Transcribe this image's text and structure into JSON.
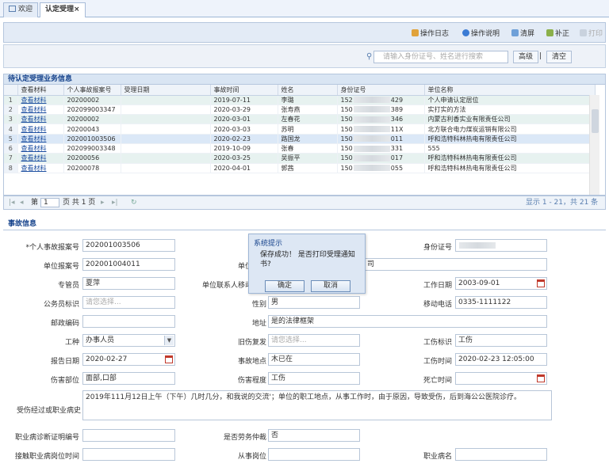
{
  "tabs": [
    {
      "label": "欢迎"
    },
    {
      "label": "认定受理",
      "close": "×"
    }
  ],
  "toolbar": {
    "items": [
      "操作日志",
      "操作说明",
      "清屏",
      "补正",
      "打印"
    ]
  },
  "search": {
    "placeholder": "请输入身份证号、姓名进行搜索",
    "advanced": "高级",
    "separator": "|",
    "clear": "清空"
  },
  "grid": {
    "title": "待认定受理业务信息",
    "columns": [
      "查看材料",
      "个人事故报案号",
      "受理日期",
      "事故时间",
      "姓名",
      "身份证号",
      "单位名称"
    ],
    "link_text": "查看材料",
    "rows": [
      {
        "n": "1",
        "case": "20200002",
        "date": "",
        "time": "2019-07-11",
        "name": "李璐",
        "id_pre": "152",
        "id_suf": "429",
        "org": "个人申请认定居位"
      },
      {
        "n": "2",
        "case": "202099003347",
        "date": "",
        "time": "2020-03-29",
        "name": "张寿燕",
        "id_pre": "150",
        "id_suf": "389",
        "org": "实打实的方法"
      },
      {
        "n": "3",
        "case": "20200002",
        "date": "",
        "time": "2020-03-01",
        "name": "左春花",
        "id_pre": "150",
        "id_suf": "346",
        "org": "内蒙古利香实业有限责任公司"
      },
      {
        "n": "4",
        "case": "20200043",
        "date": "",
        "time": "2020-03-03",
        "name": "苏明",
        "id_pre": "150",
        "id_suf": "11X",
        "org": "北方联合电力煤炭运销有限公司"
      },
      {
        "n": "5",
        "case": "202001003506",
        "date": "",
        "time": "2020-02-23",
        "name": "路国龙",
        "id_pre": "150",
        "id_suf": "011",
        "org": "呼和浩特科林热电有限责任公司"
      },
      {
        "n": "6",
        "case": "202099003348",
        "date": "",
        "time": "2019-10-09",
        "name": "张春",
        "id_pre": "150",
        "id_suf": "331",
        "org": "555"
      },
      {
        "n": "7",
        "case": "20200056",
        "date": "",
        "time": "2020-03-25",
        "name": "吴振平",
        "id_pre": "150",
        "id_suf": "017",
        "org": "呼和浩特科林热电有限责任公司"
      },
      {
        "n": "8",
        "case": "20200078",
        "date": "",
        "time": "2020-04-01",
        "name": "郭茜",
        "id_pre": "150",
        "id_suf": "055",
        "org": "呼和浩特科林热电有限责任公司"
      }
    ],
    "pager": {
      "page_label": "第",
      "page": "1",
      "of": "页 共 1 页",
      "status": "显示 1 - 21，共 21 条"
    }
  },
  "form": {
    "title": "事故信息",
    "case_no_label": "*个人事故报案号",
    "case_no": "202001003506",
    "id_label": "身份证号",
    "org_case_label": "单位报案号",
    "org_case": "202001004011",
    "org_name_label": "单位",
    "org_name_tail": "司",
    "gender_hidden_label": "专管员",
    "staff": "夏萍",
    "contact_label": "单位联系人移动",
    "work_date_label": "工作日期",
    "work_date": "2003-09-01",
    "civil_label": "公务员标识",
    "civil_ph": "请您选择...",
    "sex_label": "性别",
    "sex": "男",
    "mobile_label": "移动电话",
    "mobile": "0335-1111122",
    "zip_label": "邮政编码",
    "address_label": "地址",
    "address": "是的法律框架",
    "work_type_label": "工种",
    "work_type": "办事人员",
    "relapse_label": "旧伤复发",
    "relapse_ph": "请您选择...",
    "injury_flag_label": "工伤标识",
    "injury_flag": "工伤",
    "report_date_label": "报告日期",
    "report_date": "2020-02-27",
    "place_label": "事故地点",
    "place": "木已在",
    "injury_time_label": "工伤时间",
    "injury_time": "2020-02-23 12:05:00",
    "part_label": "伤害部位",
    "part": "面部,口部",
    "degree_label": "伤害程度",
    "degree": "工伤",
    "death_label": "死亡时间",
    "desc_label": "受伤经过或职业病史",
    "desc": "2019年111月12日上午（下午）几时几分，和我说的交流'；单位的职工地点，从事工作时，由于原因，导致受伤，后到海公公医院诊疗。",
    "cert_label": "职业病诊断证明编号",
    "lab_label": "是否劳务仲裁",
    "lab": "否",
    "expose_label": "接触职业病岗位时间",
    "post_label": "从事岗位",
    "disease_label": "职业病名"
  },
  "dialog": {
    "title": "系统提示",
    "message": "保存成功！ 是否打印受理通知书?",
    "ok": "确定",
    "cancel": "取消"
  },
  "colors": {
    "accent": "#15428b",
    "grid_alt": "#e7f2f0",
    "selected": "#dbe8f7"
  }
}
